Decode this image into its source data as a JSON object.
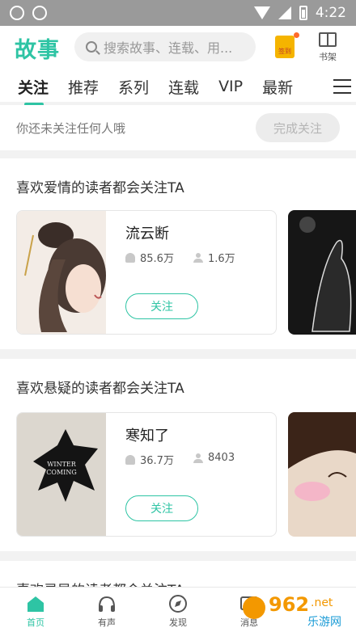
{
  "status_bar": {
    "time": "4:22"
  },
  "header": {
    "logo": "故事",
    "search_placeholder": "搜索故事、连载、用...",
    "signin_label": "签到",
    "bookshelf_label": "书架"
  },
  "tabs": [
    "关注",
    "推荐",
    "系列",
    "连载",
    "VIP",
    "最新"
  ],
  "active_tab": "关注",
  "follow_empty": {
    "message": "你还未关注任何人哦",
    "done_button": "完成关注"
  },
  "sections": [
    {
      "title": "喜欢爱情的读者都会关注TA",
      "card": {
        "name": "流云断",
        "reads": "85.6万",
        "fans": "1.6万",
        "follow_label": "关注"
      }
    },
    {
      "title": "喜欢悬疑的读者都会关注TA",
      "card": {
        "name": "寒知了",
        "reads": "36.7万",
        "fans": "8403",
        "follow_label": "关注",
        "cover_text": "WINTER COMING"
      }
    },
    {
      "title": "喜欢灵异的读者都会关注TA"
    }
  ],
  "bottom_nav": [
    {
      "label": "首页",
      "icon": "home-icon",
      "active": true
    },
    {
      "label": "有声",
      "icon": "headphones-icon",
      "active": false
    },
    {
      "label": "发现",
      "icon": "compass-icon",
      "active": false
    },
    {
      "label": "消息",
      "icon": "message-icon",
      "active": false
    }
  ],
  "watermark": {
    "brand": "962",
    "domain": ".net",
    "site": "乐游网"
  },
  "colors": {
    "accent": "#2ec4a4",
    "statusbar": "#9a9a9a",
    "background": "#f2f2f2"
  }
}
